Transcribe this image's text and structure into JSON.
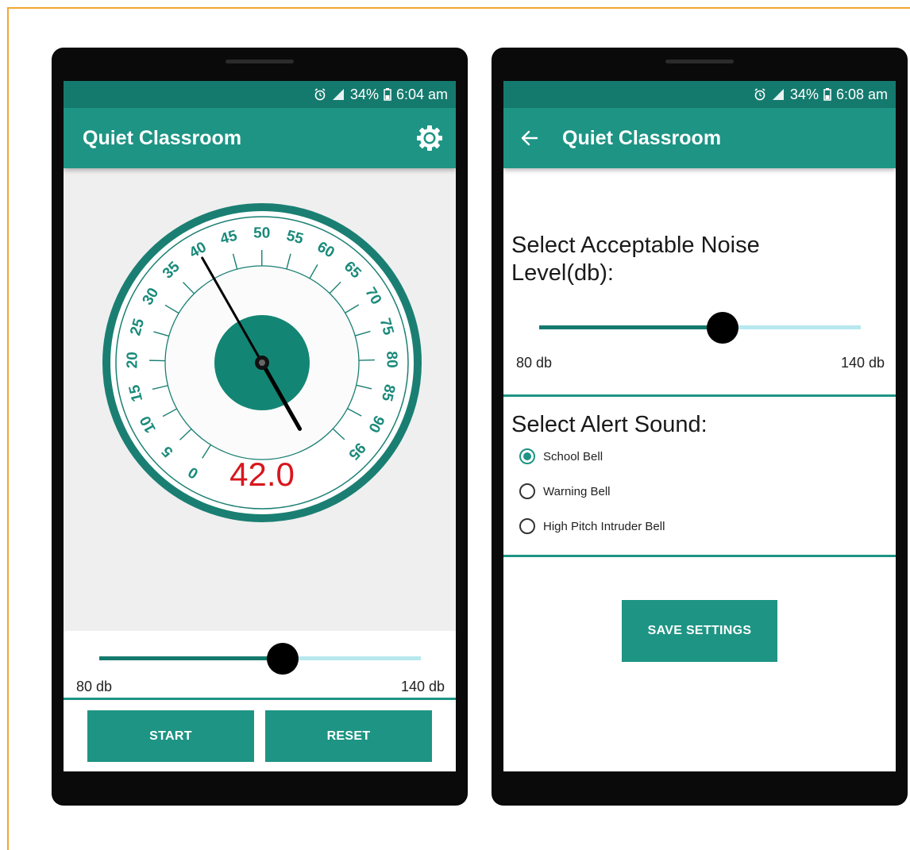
{
  "colors": {
    "status_bar": "#157a6e",
    "app_bar": "#1e9484",
    "accent": "#1e9484",
    "slider_inactive": "#b7e8ee",
    "gauge_reading": "#d8161e",
    "frame_border": "#f3a531"
  },
  "icons": {
    "alarm": "alarm-clock-icon",
    "signal": "signal-icon",
    "battery": "battery-icon",
    "settings": "gear-icon",
    "back": "arrow-left-icon"
  },
  "main_screen": {
    "status": {
      "battery_percent": "34%",
      "time": "6:04 am"
    },
    "title": "Quiet Classroom",
    "gauge": {
      "tick_labels": [
        "0",
        "5",
        "10",
        "15",
        "20",
        "25",
        "30",
        "35",
        "40",
        "45",
        "50",
        "55",
        "60",
        "65",
        "70",
        "75",
        "80",
        "85",
        "90",
        "95"
      ],
      "min": 0,
      "max": 95,
      "needle_value": 40,
      "reading": "42.0"
    },
    "slider": {
      "min_label": "80 db",
      "max_label": "140 db",
      "value_fraction": 0.57
    },
    "buttons": {
      "start": "START",
      "reset": "RESET"
    }
  },
  "settings_screen": {
    "status": {
      "battery_percent": "34%",
      "time": "6:08 am"
    },
    "title": "Quiet Classroom",
    "noise_section_title": "Select Acceptable Noise Level(db):",
    "noise_slider": {
      "min_label": "80 db",
      "max_label": "140 db",
      "value_fraction": 0.57
    },
    "alert_section_title": "Select Alert Sound:",
    "alert_options": [
      {
        "label": "School Bell",
        "selected": true
      },
      {
        "label": "Warning Bell",
        "selected": false
      },
      {
        "label": "High Pitch Intruder Bell",
        "selected": false
      }
    ],
    "save_button": "SAVE SETTINGS"
  }
}
